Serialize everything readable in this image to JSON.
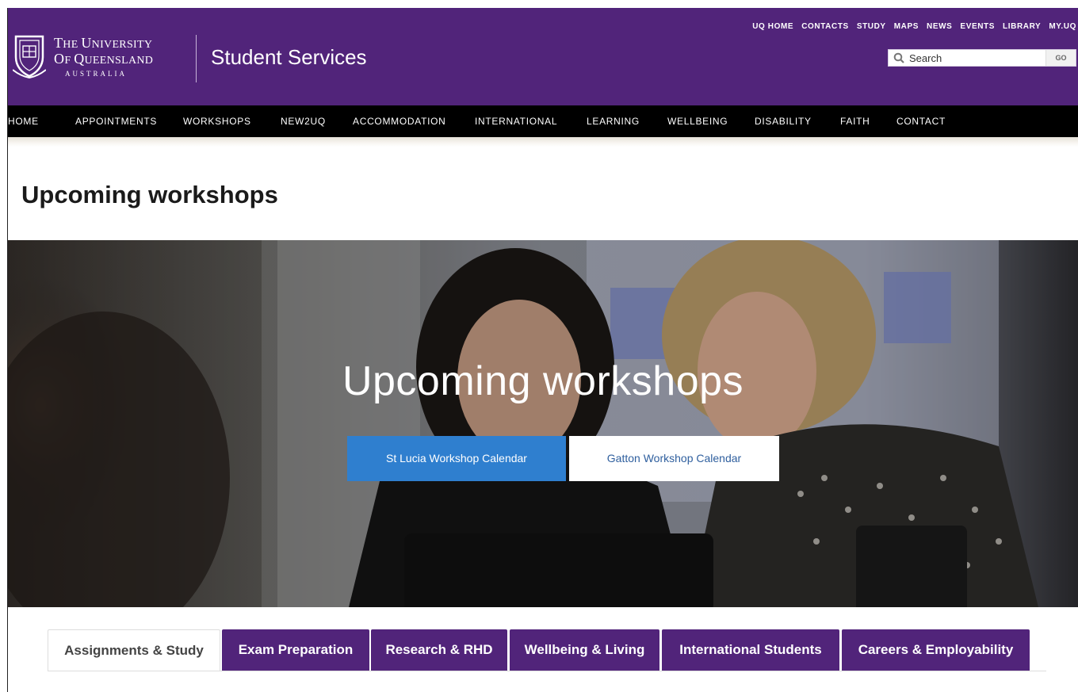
{
  "brand": {
    "university_line1": "The University",
    "university_line2": "of Queensland",
    "university_line3": "AUSTRALIA",
    "site_name": "Student Services",
    "header_color": "#51247a",
    "accent_blue": "#2f7fcf"
  },
  "utility_nav": [
    "UQ HOME",
    "CONTACTS",
    "STUDY",
    "MAPS",
    "NEWS",
    "EVENTS",
    "LIBRARY",
    "MY.UQ"
  ],
  "search": {
    "placeholder": "Search",
    "go_label": "GO",
    "icon": "search-icon"
  },
  "main_nav": [
    "HOME",
    "APPOINTMENTS",
    "WORKSHOPS",
    "NEW2UQ",
    "ACCOMMODATION",
    "INTERNATIONAL",
    "LEARNING",
    "WELLBEING",
    "DISABILITY",
    "FAITH",
    "CONTACT"
  ],
  "page": {
    "title": "Upcoming workshops"
  },
  "hero": {
    "heading": "Upcoming workshops",
    "buttons": [
      "St Lucia Workshop Calendar",
      "Gatton Workshop Calendar"
    ]
  },
  "tabs": [
    {
      "label": "Assignments & Study",
      "active": true
    },
    {
      "label": "Exam Preparation",
      "active": false
    },
    {
      "label": "Research & RHD",
      "active": false
    },
    {
      "label": "Wellbeing & Living",
      "active": false
    },
    {
      "label": "International Students",
      "active": false
    },
    {
      "label": "Careers & Employability",
      "active": false
    }
  ]
}
